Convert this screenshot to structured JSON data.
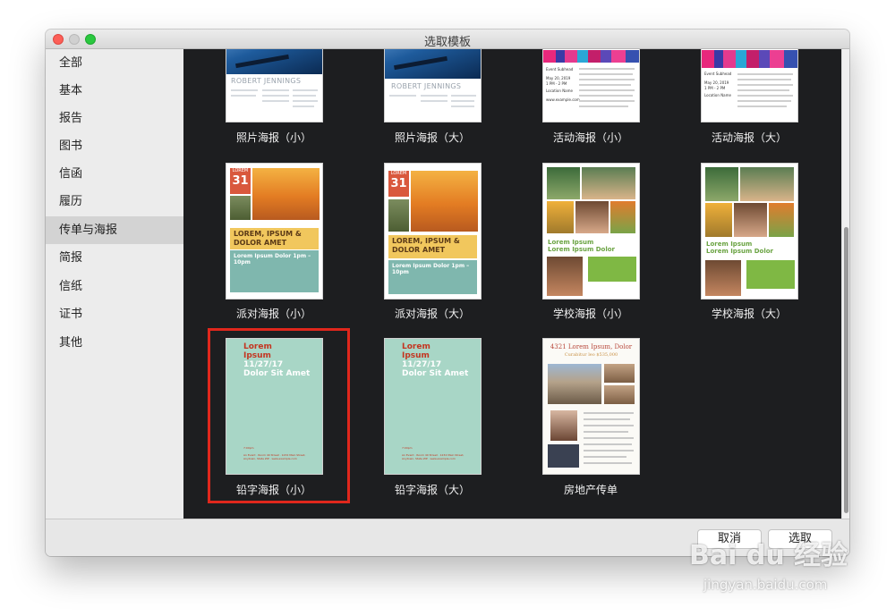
{
  "window": {
    "title": "选取模板"
  },
  "sidebar": {
    "items": [
      {
        "label": "全部",
        "selected": false
      },
      {
        "label": "基本",
        "selected": false
      },
      {
        "label": "报告",
        "selected": false
      },
      {
        "label": "图书",
        "selected": false
      },
      {
        "label": "信函",
        "selected": false
      },
      {
        "label": "履历",
        "selected": false
      },
      {
        "label": "传单与海报",
        "selected": true
      },
      {
        "label": "简报",
        "selected": false
      },
      {
        "label": "信纸",
        "selected": false
      },
      {
        "label": "证书",
        "selected": false
      },
      {
        "label": "其他",
        "selected": false
      }
    ]
  },
  "templates": {
    "row1": [
      "照片海报（小）",
      "照片海报（大）",
      "活动海报（小）",
      "活动海报（大）"
    ],
    "row2": [
      "派对海报（小）",
      "派对海报（大）",
      "学校海报（小）",
      "学校海报（大）"
    ],
    "row3": [
      "铅字海报（小）",
      "铅字海报（大）",
      "房地产传单"
    ],
    "selected": "铅字海报（小）"
  },
  "previews": {
    "photo_name": "ROBERT JENNINGS",
    "event_heading": "Event Subhead",
    "event_date": "May 20, 2019",
    "event_time": "1 PM - 2 PM",
    "event_location": "Location Name",
    "event_url": "www.example.com",
    "party_month": "LOREM",
    "party_day": "31",
    "party_headline": "LOREM, IPSUM & DOLOR AMET",
    "party_time": "Lorem Ipsum Dolor 1pm – 10pm",
    "school_title_1": "Lorem Ipsum",
    "school_title_2": "Lorem Ipsum Dolor",
    "pencil_line1": "Lorem",
    "pencil_line2": "Ipsum",
    "pencil_line3": "11/27/17",
    "pencil_line4": "Dolor Sit Amet",
    "pencil_time": "7:00pm",
    "pencil_address": "An Event · Room 40 Street · 1234 Main Street, Anytown, State ZIP · www.example.com",
    "realestate_title": "4321 Lorem Ipsum, Dolor",
    "realestate_sub": "Curabitur leo $535,000"
  },
  "footer": {
    "cancel_label": "取消",
    "choose_label": "选取"
  },
  "watermark": {
    "brand": "Bai du 经验",
    "url": "jingyan.baidu.com"
  },
  "colors": {
    "selection_border": "#e0271c",
    "content_bg": "#1d1e20",
    "sidebar_selected": "#d3d3d3",
    "pencil_bg": "#a8d6c6",
    "pencil_text": "#c43520"
  }
}
